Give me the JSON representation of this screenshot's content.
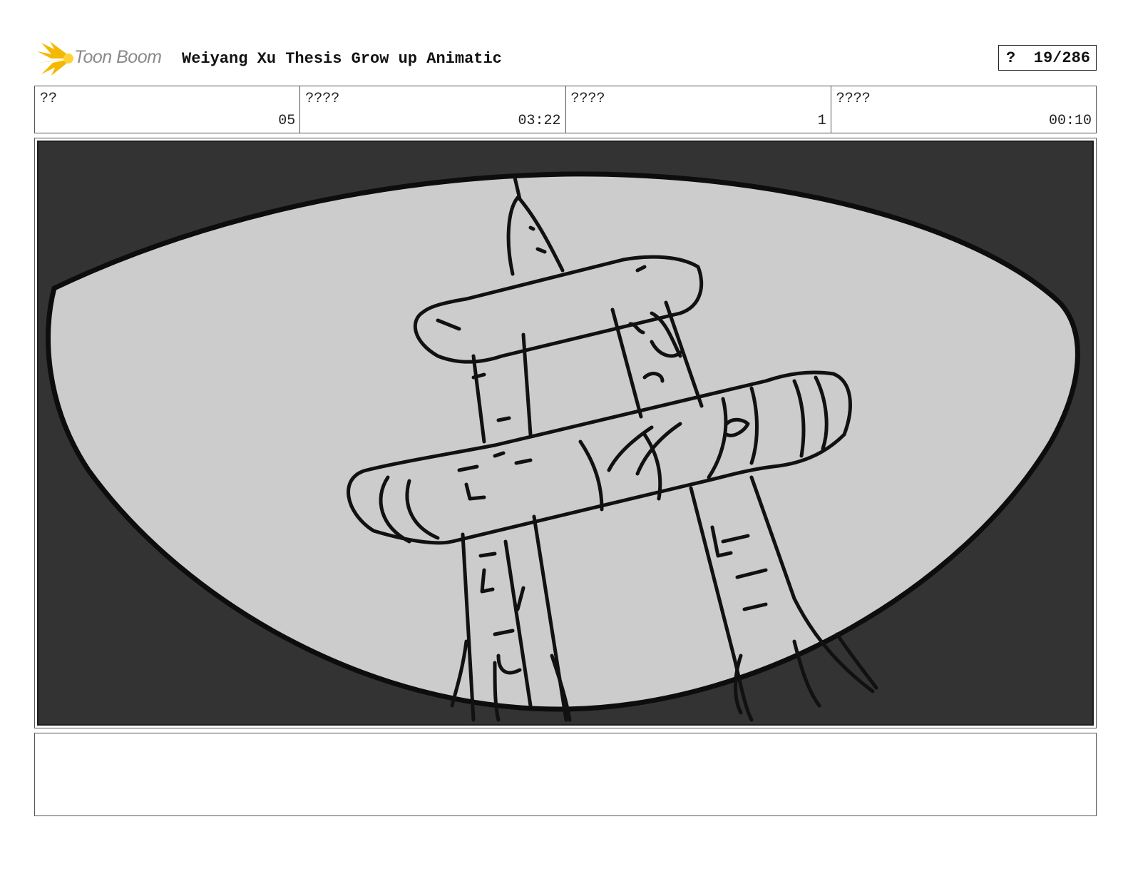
{
  "header": {
    "logo_text": "Toon Boom",
    "title": "Weiyang Xu Thesis Grow up Animatic",
    "page_marker": "?",
    "page_number": "19/286"
  },
  "info": [
    {
      "label": "??",
      "value": "05"
    },
    {
      "label": "????",
      "value": "03:22"
    },
    {
      "label": "????",
      "value": "1"
    },
    {
      "label": "????",
      "value": "00:10"
    }
  ],
  "panel": {
    "image": "storyboard-sketch-tower",
    "background_color": "#333333",
    "lens_color": "#cccccc"
  },
  "notes": {
    "text": ""
  }
}
